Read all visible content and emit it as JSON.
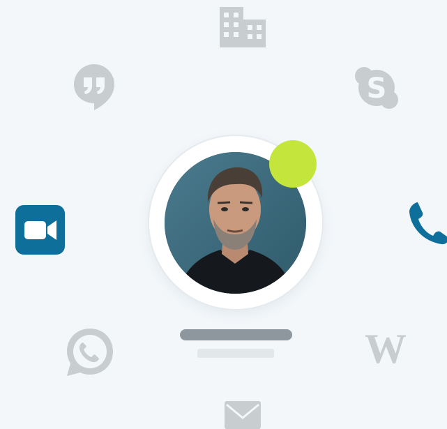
{
  "contact_card": {
    "status": "online",
    "status_color": "#c4e63c",
    "accent_color": "#0e6f9a",
    "inactive_icon_color": "#c8cdd0"
  },
  "channels": [
    {
      "icon": "building-icon",
      "active": false
    },
    {
      "icon": "skype-icon",
      "active": false
    },
    {
      "icon": "phone-icon",
      "active": true
    },
    {
      "icon": "wordpress-icon",
      "active": false
    },
    {
      "icon": "mail-icon",
      "active": false
    },
    {
      "icon": "whatsapp-icon",
      "active": false
    },
    {
      "icon": "video-call-icon",
      "active": true
    },
    {
      "icon": "hangouts-icon",
      "active": false
    }
  ]
}
